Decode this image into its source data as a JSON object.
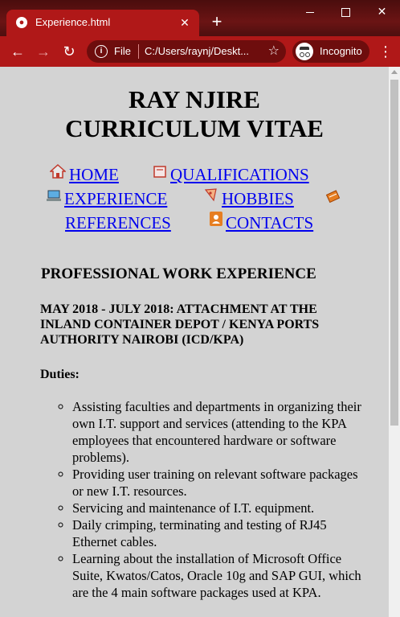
{
  "browser": {
    "tab_title": "Experience.html",
    "scheme_label": "File",
    "url": "C:/Users/raynj/Deskt...",
    "incognito_label": "Incognito"
  },
  "page": {
    "name": "RAY NJIRE",
    "subtitle": "CURRICULUM VITAE",
    "nav": {
      "home": "HOME",
      "qualifications": "QUALIFICATIONS",
      "experience": "EXPERIENCE",
      "hobbies": "HOBBIES",
      "references": "REFERENCES",
      "contacts": "CONTACTS"
    },
    "section_title": "PROFESSIONAL WORK EXPERIENCE",
    "job_title": "MAY 2018 - JULY 2018: ATTACHMENT AT THE INLAND CONTAINER DEPOT / KENYA PORTS AUTHORITY NAIROBI (ICD/KPA)",
    "duties_label": "Duties:",
    "duties": [
      "Assisting faculties and departments in organizing their own I.T. support and services (attending to the KPA employees that encountered hardware or software problems).",
      "Providing user training on relevant software packages or new I.T. resources.",
      "Servicing and maintenance of I.T. equipment.",
      "Daily crimping, terminating and testing of RJ45 Ethernet cables.",
      "Learning about the installation of Microsoft Office Suite, Kwatos/Catos, Oracle 10g and SAP GUI, which are the 4 main software packages used at KPA."
    ]
  },
  "colors": {
    "chrome_red": "#b01818",
    "page_bg": "#d3d3d3",
    "link": "#0000ee"
  }
}
